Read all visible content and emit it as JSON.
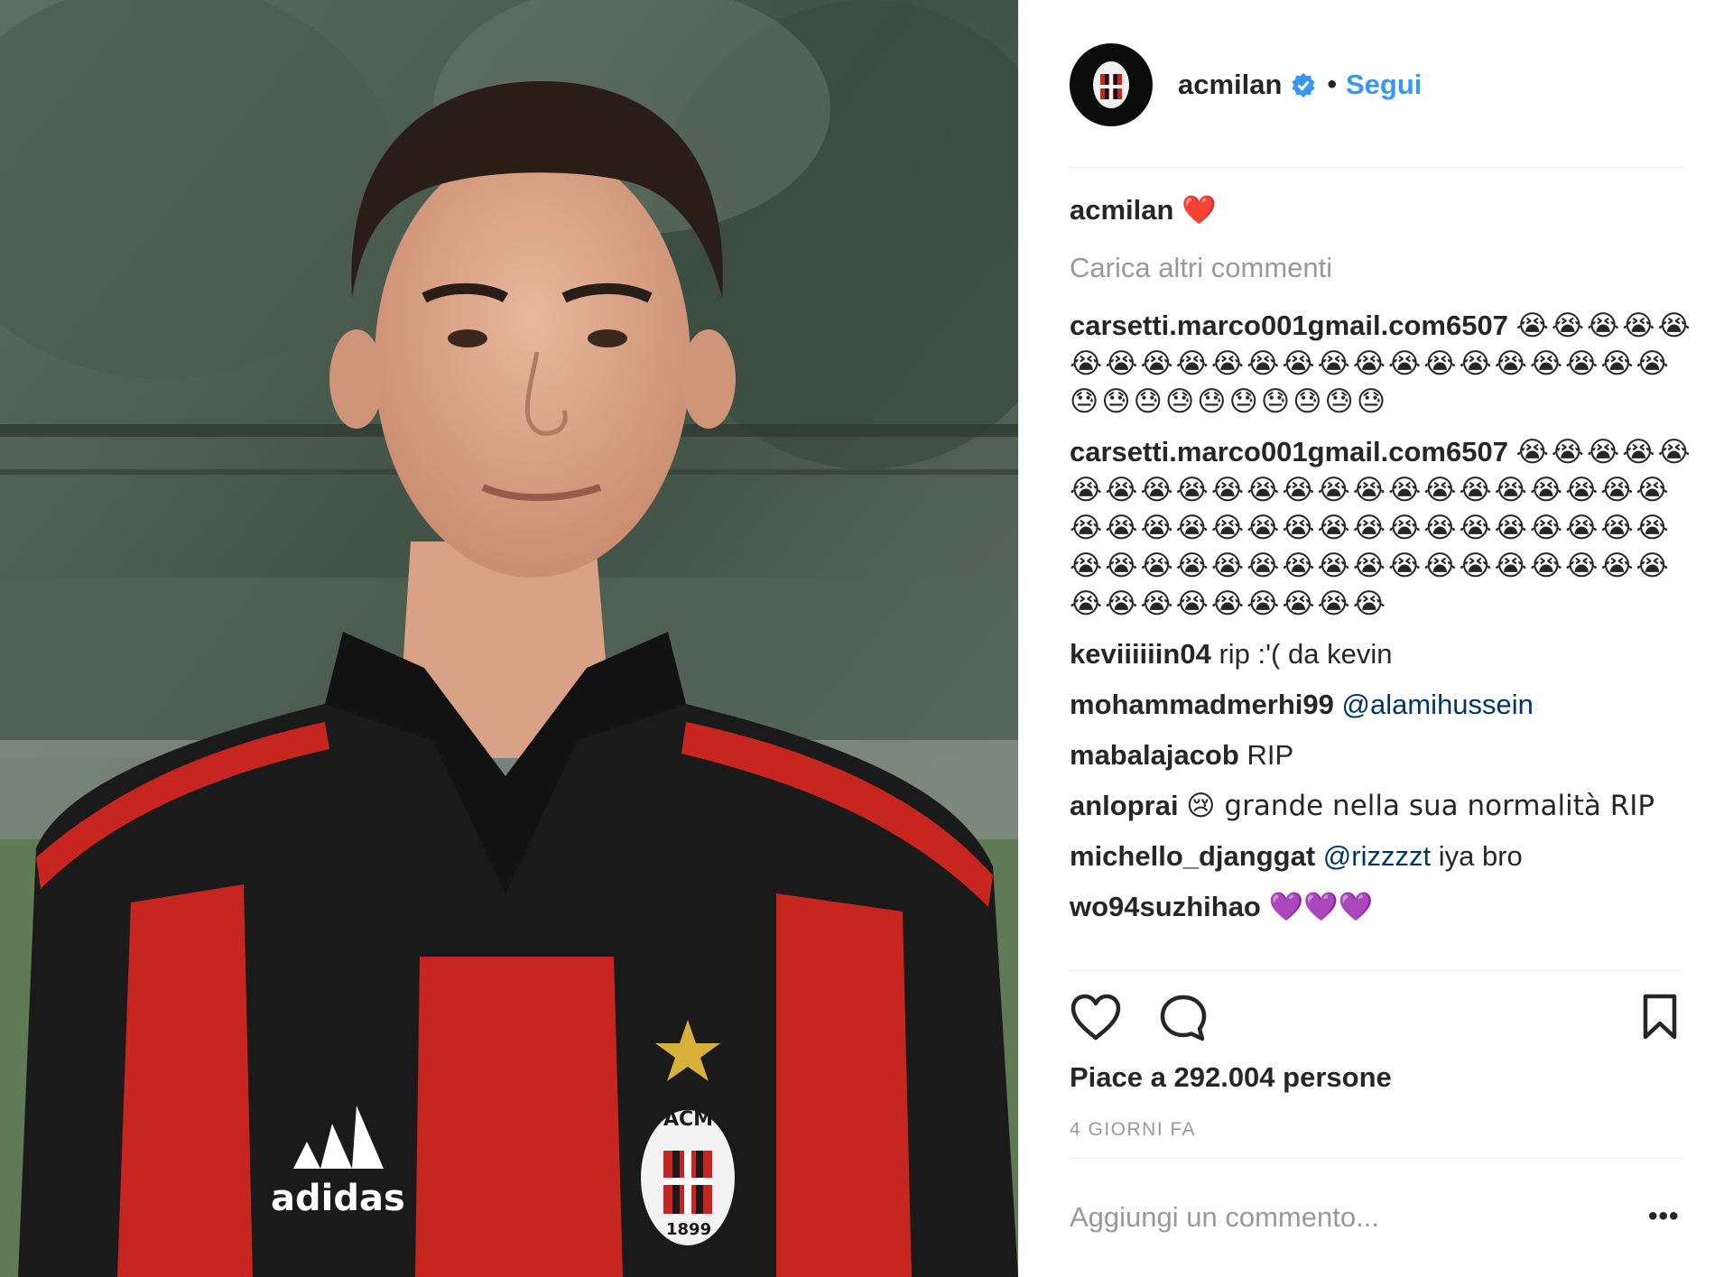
{
  "post": {
    "photo": {
      "description_icon": "footballer-portrait-photo",
      "shirt_brand": "adidas",
      "crest_top": "ACM",
      "crest_year": "1899"
    },
    "account": {
      "username": "acmilan",
      "verified_icon": "verified-badge-icon",
      "separator": "•",
      "follow_label": "Segui",
      "avatar_icon": "ac-milan-crest-icon"
    },
    "caption": {
      "username": "acmilan",
      "text": "❤️"
    },
    "load_more_label": "Carica altri commenti",
    "comments": [
      {
        "username": "carsetti.marco001gmail.com6507",
        "text": "😭😭😭😭😭😭😭😭😭😭😭😭😭😭😭😭😭😭😭😭😭😭😓😓😓😓😓😓😓😓😓😓"
      },
      {
        "username": "carsetti.marco001gmail.com6507",
        "text": "😭😭😭😭😭😭😭😭😭😭😭😭😭😭😭😭😭😭😭😭😭😭😭😭😭😭😭😭😭😭😭😭😭😭😭😭😭😭😭😭😭😭😭😭😭😭😭😭😭😭😭😭😭😭😭😭😭😭😭😭😭😭😭😭😭"
      },
      {
        "username": "keviiiiiin04",
        "text": "rip :'( da kevin"
      },
      {
        "username": "mohammadmerhi99",
        "mention": "@alamihussein",
        "text": ""
      },
      {
        "username": "mabalajacob",
        "text": "RIP"
      },
      {
        "username": "anloprai",
        "text": "😢  grande nella sua normalità RIP"
      },
      {
        "username": "michello_djanggat",
        "mention": "@rizzzzt",
        "text": "iya bro"
      },
      {
        "username": "wo94suzhihao",
        "text": "💜💜💜"
      }
    ],
    "actions": {
      "like_icon": "heart-icon",
      "comment_icon": "comment-bubble-icon",
      "save_icon": "bookmark-icon"
    },
    "likes_label": "Piace a 292.004 persone",
    "timestamp": "4 GIORNI FA",
    "add_comment_placeholder": "Aggiungi un commento...",
    "more_label": "•••"
  }
}
